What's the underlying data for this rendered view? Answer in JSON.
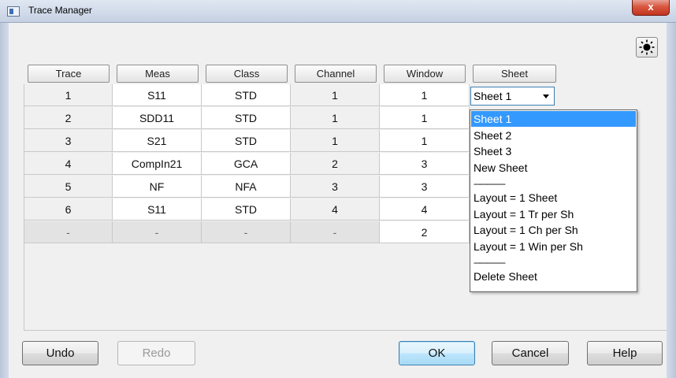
{
  "window": {
    "title": "Trace Manager",
    "close_glyph": "x"
  },
  "columns": [
    "Trace",
    "Meas",
    "Class",
    "Channel",
    "Window",
    "Sheet"
  ],
  "rows": [
    [
      "1",
      "S11",
      "STD",
      "1",
      "1"
    ],
    [
      "2",
      "SDD11",
      "STD",
      "1",
      "1"
    ],
    [
      "3",
      "S21",
      "STD",
      "1",
      "1"
    ],
    [
      "4",
      "CompIn21",
      "GCA",
      "2",
      "3"
    ],
    [
      "5",
      "NF",
      "NFA",
      "3",
      "3"
    ],
    [
      "6",
      "S11",
      "STD",
      "4",
      "4"
    ],
    [
      "-",
      "-",
      "-",
      "-",
      "2"
    ]
  ],
  "sheet_combo": {
    "value": "Sheet 1"
  },
  "sheet_menu": [
    "Sheet 1",
    "Sheet 2",
    "Sheet 3",
    "New Sheet",
    "---------------",
    "Layout = 1 Sheet",
    "Layout = 1 Tr per Sh",
    "Layout = 1 Ch per Sh",
    "Layout = 1 Win per Sh",
    "---------------",
    "Delete Sheet"
  ],
  "buttons": {
    "undo": "Undo",
    "redo": "Redo",
    "ok": "OK",
    "cancel": "Cancel",
    "help": "Help"
  },
  "icons": {
    "brightness": "sun-icon",
    "window_menu": "app-icon",
    "close": "close-icon"
  },
  "colors": {
    "selection": "#3399ff",
    "title_bar": "#d3dceb",
    "close": "#c3341f"
  }
}
